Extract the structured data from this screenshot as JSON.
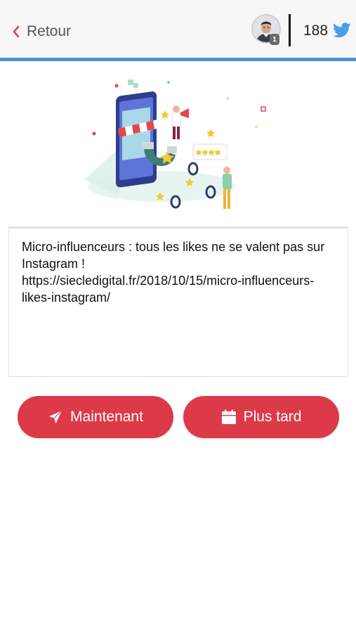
{
  "header": {
    "back_label": "Retour",
    "avatar_badge": "1",
    "count": "188",
    "accent_color": "#4a90d9",
    "icons": {
      "back": "chevron-left-icon",
      "network": "twitter-icon"
    }
  },
  "illustration": {
    "name": "influencer-marketing-illustration"
  },
  "composer": {
    "text": "Micro-influenceurs : tous les likes ne se valent pas sur Instagram !\nhttps://siecledigital.fr/2018/10/15/micro-influenceurs-likes-instagram/"
  },
  "actions": {
    "now_label": "Maintenant",
    "now_icon": "paper-plane-icon",
    "later_label": "Plus tard",
    "later_icon": "calendar-icon",
    "button_color": "#dc3a48"
  }
}
